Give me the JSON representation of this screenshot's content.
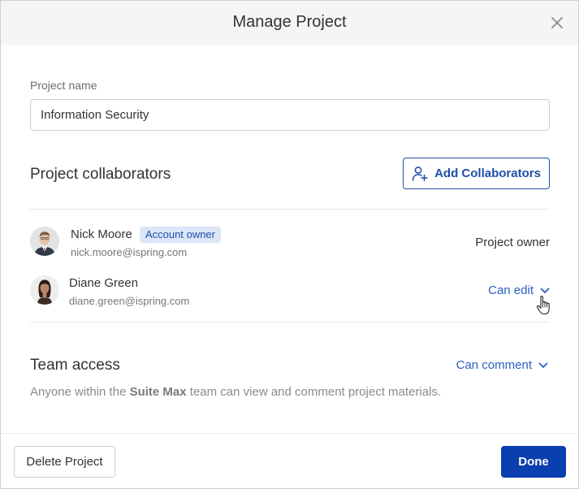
{
  "dialog": {
    "title": "Manage Project"
  },
  "project_name": {
    "label": "Project name",
    "value": "Information Security"
  },
  "collaborators": {
    "title": "Project collaborators",
    "add_button_label": "Add Collaborators",
    "people": [
      {
        "name": "Nick Moore",
        "badge": "Account owner",
        "email": "nick.moore@ispring.com",
        "role": "Project owner"
      },
      {
        "name": "Diane Green",
        "email": "diane.green@ispring.com",
        "role": "Can edit"
      }
    ]
  },
  "team_access": {
    "title": "Team access",
    "permission": "Can comment",
    "desc_prefix": "Anyone within the ",
    "team_name": "Suite Max",
    "desc_suffix": " team can view and comment project materials."
  },
  "footer": {
    "delete_label": "Delete Project",
    "done_label": "Done"
  },
  "colors": {
    "accent": "#1f4fa8",
    "primary_button": "#0a3fb0",
    "badge_bg": "#dbe6f7",
    "link": "#2a5fc1"
  },
  "icons": [
    "close-icon",
    "add-user-icon",
    "chevron-down-icon",
    "hand-cursor-icon"
  ]
}
